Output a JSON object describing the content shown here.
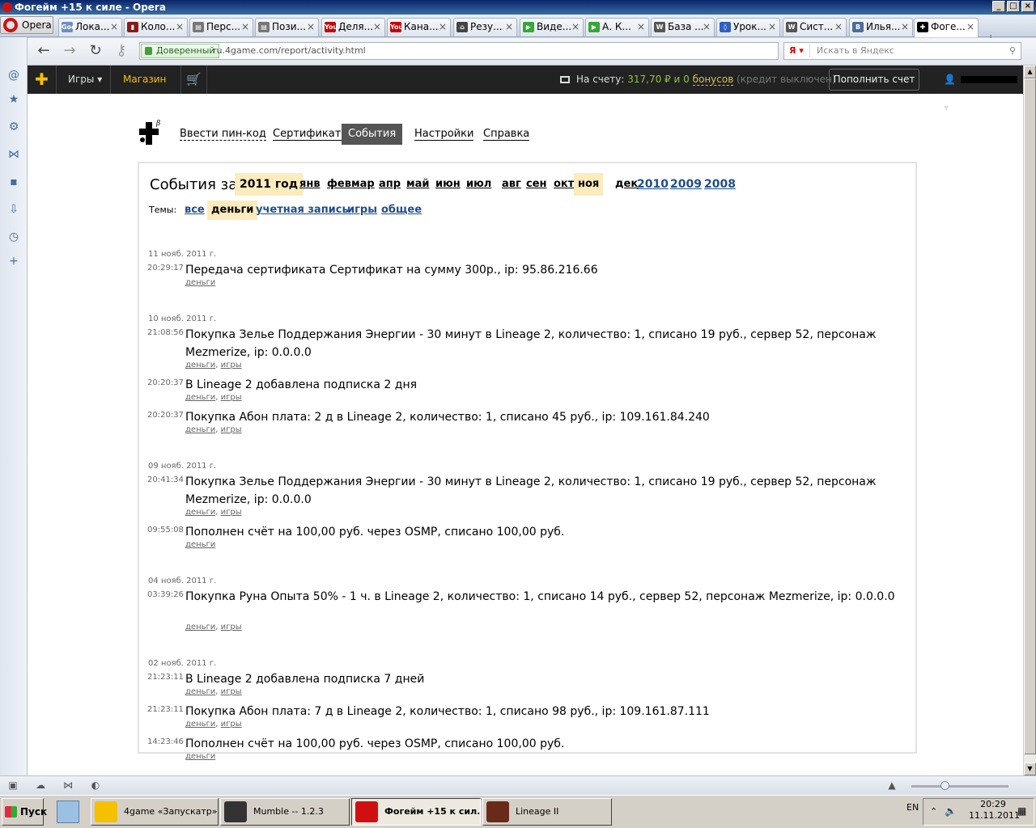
{
  "window": {
    "title": "Фогейм +15 к силе - Opera",
    "min": "_",
    "max": "□",
    "close": "×"
  },
  "opera_menu": "Opera",
  "tabs": [
    {
      "label": "Лока...",
      "fav": "God",
      "color": "#6a8fc2"
    },
    {
      "label": "Коло...",
      "fav": "▮",
      "color": "#8b1a1a"
    },
    {
      "label": "Перс...",
      "fav": "▤",
      "color": "#777"
    },
    {
      "label": "Пози...",
      "fav": "▤",
      "color": "#777"
    },
    {
      "label": "Деля...",
      "fav": "You",
      "color": "#c00"
    },
    {
      "label": "Кана...",
      "fav": "You",
      "color": "#c00"
    },
    {
      "label": "Резу...",
      "fav": "⌂",
      "color": "#444"
    },
    {
      "label": "Виде...",
      "fav": "▶",
      "color": "#3a3"
    },
    {
      "label": "А. К...",
      "fav": "▶",
      "color": "#3a3"
    },
    {
      "label": "База ...",
      "fav": "W",
      "color": "#555"
    },
    {
      "label": "Урок...",
      "fav": "◊",
      "color": "#3060c0"
    },
    {
      "label": "Сист...",
      "fav": "W",
      "color": "#555"
    },
    {
      "label": "Илья...",
      "fav": "В",
      "color": "#4a6e9a"
    },
    {
      "label": "Фоге...",
      "fav": "✚",
      "color": "#000"
    }
  ],
  "address": {
    "trusted": "Доверенный",
    "url": "ru.4game.com/report/activity.html",
    "search_engine": "Я",
    "search_placeholder": "Искать в Яндекс"
  },
  "site": {
    "games": "Игры",
    "shop": "Магазин",
    "balance_label": "На счету:",
    "balance_value": "317,70 ₽",
    "and_zero": "и 0",
    "bonuses": "бонусов",
    "credit": "(кредит выключен)",
    "topup": "Пополнить счет"
  },
  "subnav": [
    "Ввести пин-код",
    "Сертификаты",
    "События",
    "Настройки",
    "Справка"
  ],
  "subnav_beta": "β",
  "events_title": "События за",
  "year": "2011 год",
  "months": [
    "янв",
    "фев",
    "мар",
    "апр",
    "май",
    "июн",
    "июл",
    "авг",
    "сен",
    "окт",
    "ноя",
    "дек"
  ],
  "selected_month": "ноя",
  "other_years": [
    "2010",
    "2009",
    "2008"
  ],
  "themes_label": "Темы:",
  "themes": [
    "все",
    "деньги",
    "учетная запись",
    "игры",
    "общее"
  ],
  "selected_theme": "деньги",
  "days": [
    {
      "date": "11 нояб. 2011 г.",
      "events": [
        {
          "time": "20:29:17",
          "text": "Передача сертификата Сертификат на сумму 300р., ip: 95.86.216.66",
          "tags": [
            "деньги"
          ]
        }
      ]
    },
    {
      "date": "10 нояб. 2011 г.",
      "events": [
        {
          "time": "21:08:56",
          "text": "Покупка Зелье Поддержания Энергии - 30 минут в Lineage 2, количество: 1, списано 19 руб., сервер 52, персонаж Mezmerize, ip: 0.0.0.0",
          "tags": [
            "деньги",
            "игры"
          ]
        },
        {
          "time": "20:20:37",
          "text": "В Lineage 2 добавлена подписка 2 дня",
          "tags": [
            "деньги",
            "игры"
          ]
        },
        {
          "time": "20:20:37",
          "text": "Покупка Абон плата: 2 д в Lineage 2, количество: 1, списано 45 руб., ip: 109.161.84.240",
          "tags": [
            "деньги",
            "игры"
          ]
        }
      ]
    },
    {
      "date": "09 нояб. 2011 г.",
      "events": [
        {
          "time": "20:41:34",
          "text": "Покупка Зелье Поддержания Энергии - 30 минут в Lineage 2, количество: 1, списано 19 руб., сервер 52, персонаж Mezmerize, ip: 0.0.0.0",
          "tags": [
            "деньги",
            "игры"
          ]
        },
        {
          "time": "09:55:08",
          "text": "Пополнен счёт на 100,00 руб. через OSMP, списано 100,00 руб.",
          "tags": [
            "деньги"
          ]
        }
      ]
    },
    {
      "date": "04 нояб. 2011 г.",
      "events": [
        {
          "time": "03:39:26",
          "text": "Покупка Руна Опыта 50% - 1 ч. в Lineage 2, количество: 1, списано 14 руб., сервер 52, персонаж Mezmerize, ip: 0.0.0.0",
          "tags": [
            "деньги",
            "игры"
          ]
        }
      ]
    },
    {
      "date": "02 нояб. 2011 г.",
      "events": [
        {
          "time": "21:23:11",
          "text": "В Lineage 2 добавлена подписка 7 дней",
          "tags": [
            "деньги",
            "игры"
          ]
        },
        {
          "time": "21:23:11",
          "text": "Покупка Абон плата: 7 д в Lineage 2, количество: 1, списано 98 руб., ip: 109.161.87.111",
          "tags": [
            "деньги",
            "игры"
          ]
        },
        {
          "time": "14:23:46",
          "text": "Пополнен счёт на 100,00 руб. через OSMP, списано 100,00 руб.",
          "tags": [
            "деньги"
          ]
        }
      ]
    }
  ],
  "taskbar": {
    "start": "Пуск",
    "tasks": [
      {
        "label": "4game «Запускатр»",
        "color": "#f5c000"
      },
      {
        "label": "Mumble -- 1.2.3",
        "color": "#333"
      },
      {
        "label": "Фогейм +15 к сил...",
        "color": "#d01010"
      },
      {
        "label": "Lineage II",
        "color": "#6a2a1a"
      }
    ],
    "lang": "EN",
    "time": "20:29",
    "date": "11.11.2011"
  }
}
